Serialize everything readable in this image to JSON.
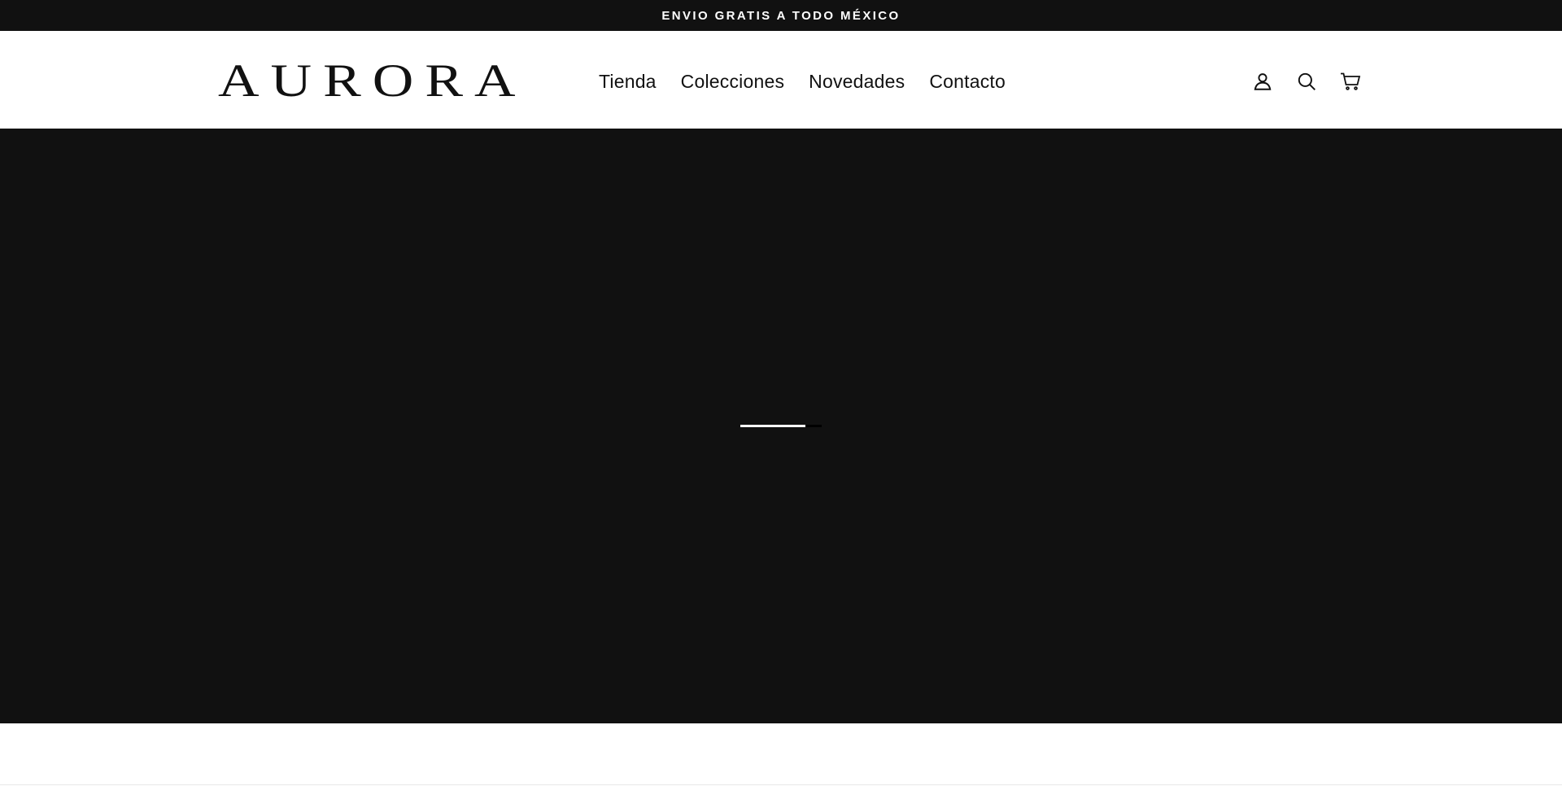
{
  "announcement": {
    "text": "ENVIO GRATIS A TODO MÉXICO"
  },
  "header": {
    "logo_text": "AURORA",
    "nav": [
      {
        "label": "Tienda"
      },
      {
        "label": "Colecciones"
      },
      {
        "label": "Novedades"
      },
      {
        "label": "Contacto"
      }
    ],
    "icons": {
      "account": "user-icon",
      "search": "search-icon",
      "cart": "cart-icon"
    }
  },
  "hero": {
    "slideshow_progress": 0.8
  },
  "colors": {
    "bar": "#111111",
    "hero": "#111111",
    "text_dark": "#111111",
    "loader_fill": "#ffffff"
  }
}
